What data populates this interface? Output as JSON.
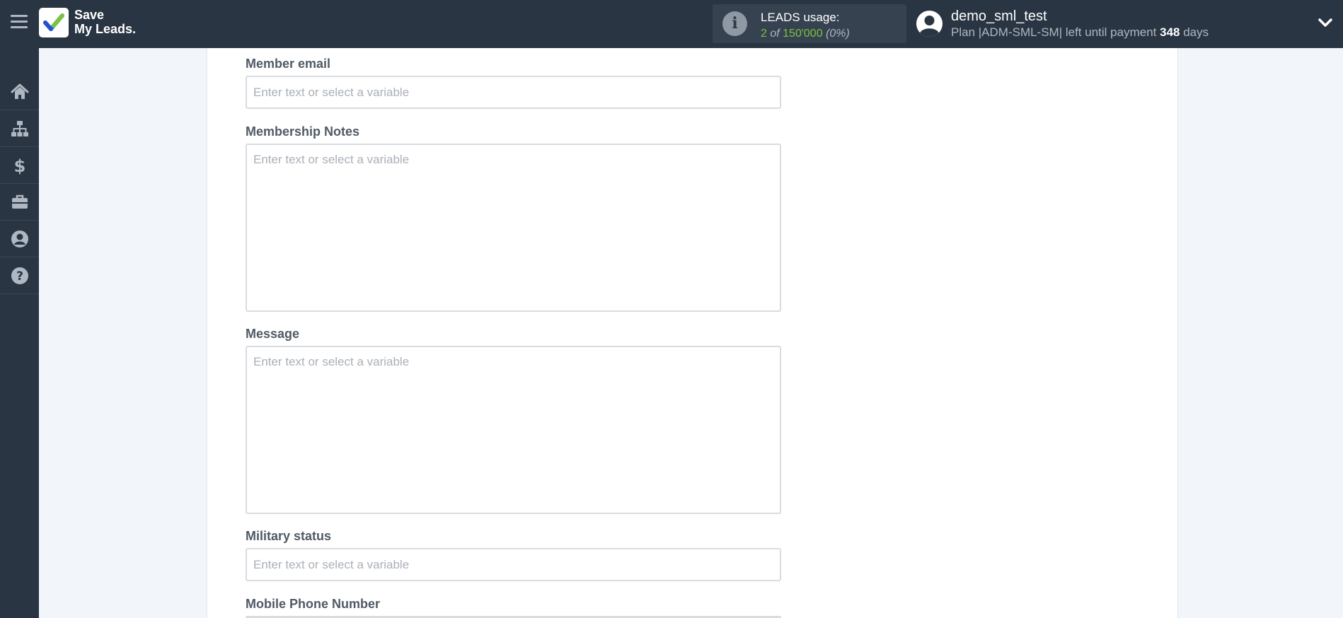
{
  "app": {
    "logo_line1": "Save",
    "logo_line2": "My Leads."
  },
  "usage": {
    "title": "LEADS usage:",
    "used": "2",
    "of_word": "of",
    "limit": "150'000",
    "percent": "(0%)"
  },
  "user": {
    "name": "demo_sml_test",
    "plan_prefix": "Plan |ADM-SML-SM| left until payment",
    "days_left": "348",
    "days_word": "days"
  },
  "sidebar": {
    "items": [
      {
        "icon": "home-icon"
      },
      {
        "icon": "sitemap-icon"
      },
      {
        "icon": "dollar-icon"
      },
      {
        "icon": "briefcase-icon"
      },
      {
        "icon": "user-circle-icon"
      },
      {
        "icon": "question-circle-icon"
      }
    ]
  },
  "form": {
    "placeholder": "Enter text or select a variable",
    "fields": [
      {
        "label": "Member email",
        "value": ""
      },
      {
        "label": "Membership Notes",
        "value": ""
      },
      {
        "label": "Message",
        "value": ""
      },
      {
        "label": "Military status",
        "value": ""
      },
      {
        "label": "Mobile Phone Number",
        "value": ""
      }
    ]
  },
  "colors": {
    "topbar": "#2a3543",
    "accent_green": "#7dc142",
    "page_bg": "#f2f5fa"
  }
}
